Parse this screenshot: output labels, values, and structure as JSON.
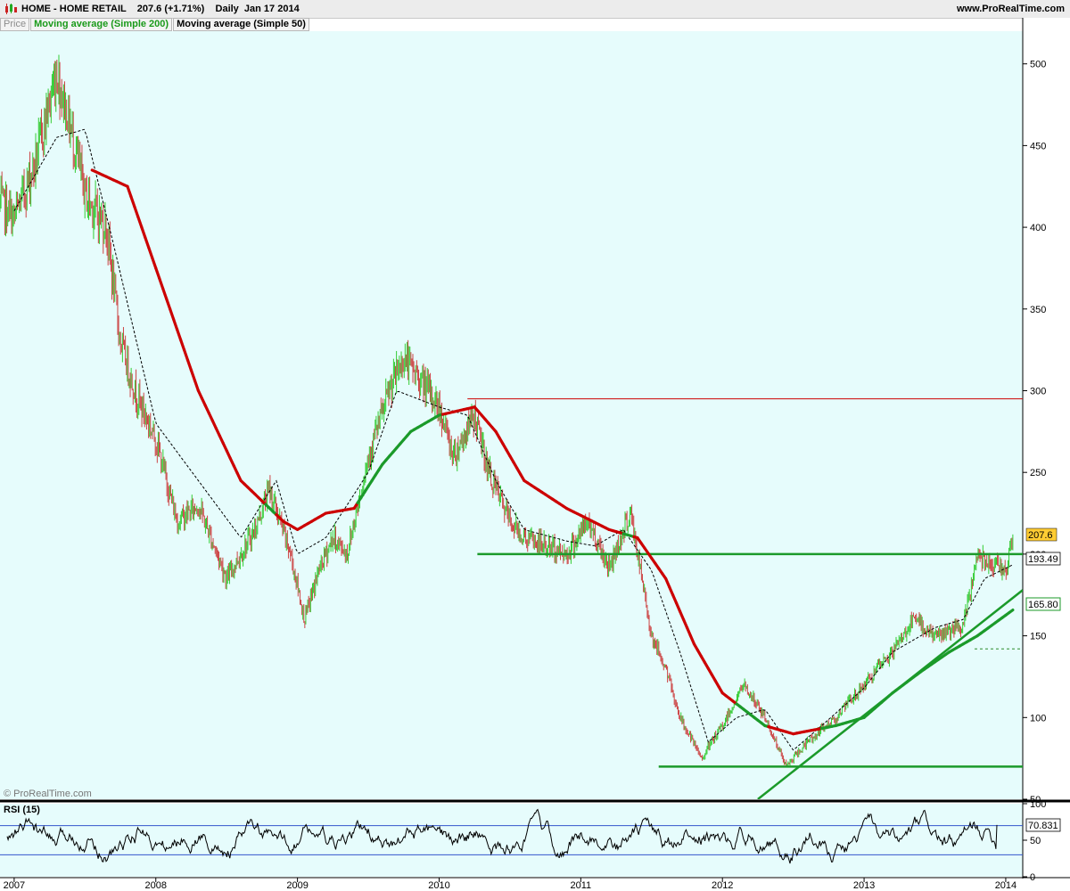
{
  "header": {
    "title": "HOME - HOME RETAIL    207.6 (+1.71%)    Daily  Jan 17 2014",
    "brand": "www.ProRealTime.com"
  },
  "legend": {
    "price": "Price",
    "ma200": "Moving average (Simple 200)",
    "ma50": "Moving average (Simple 50)"
  },
  "copyright": "© ProRealTime.com",
  "rsi_panel": {
    "title": "RSI (15)",
    "value_badge": "70.831"
  },
  "badges": {
    "last_price": "207.6",
    "ma50_value": "193.49",
    "ma200_value": "165.80"
  },
  "colors": {
    "background": "#e6fcfc",
    "up_bar": "#33cc33",
    "down_bar": "#cc4444",
    "ma200_above": "#cc0000",
    "ma200_below": "#1b9a2a",
    "ma50": "#000000",
    "trendline": "#1b9a2a",
    "resistance": "#cc0000"
  },
  "chart_data": [
    {
      "type": "line",
      "title": "HOME - HOME RETAIL",
      "period": "Daily",
      "ylim": [
        50,
        520
      ],
      "yticks": [
        50,
        100,
        150,
        200,
        250,
        300,
        350,
        400,
        450,
        500
      ],
      "x_labels": [
        "2007",
        "2008",
        "2009",
        "2010",
        "2011",
        "2012",
        "2013",
        "2014"
      ],
      "x_range": [
        2006.9,
        2014.12
      ],
      "last_close": 207.6,
      "change_pct": 1.71,
      "price_keypoints": {
        "x": [
          2006.9,
          2007.0,
          2007.15,
          2007.3,
          2007.4,
          2007.5,
          2007.65,
          2007.75,
          2007.85,
          2008.0,
          2008.15,
          2008.3,
          2008.5,
          2008.7,
          2008.8,
          2008.95,
          2009.05,
          2009.15,
          2009.25,
          2009.35,
          2009.5,
          2009.65,
          2009.75,
          2009.88,
          2010.0,
          2010.1,
          2010.25,
          2010.35,
          2010.5,
          2010.6,
          2010.75,
          2010.9,
          2011.05,
          2011.2,
          2011.35,
          2011.5,
          2011.6,
          2011.7,
          2011.85,
          2012.0,
          2012.15,
          2012.3,
          2012.45,
          2012.6,
          2012.8,
          2013.0,
          2013.2,
          2013.35,
          2013.5,
          2013.7,
          2013.8,
          2013.9,
          2014.0,
          2014.05
        ],
        "y": [
          415,
          405,
          440,
          495,
          460,
          420,
          400,
          330,
          300,
          270,
          220,
          230,
          185,
          215,
          240,
          200,
          160,
          190,
          210,
          200,
          260,
          300,
          320,
          305,
          290,
          260,
          285,
          250,
          220,
          210,
          205,
          200,
          220,
          192,
          225,
          150,
          130,
          100,
          75,
          95,
          120,
          100,
          70,
          85,
          100,
          120,
          140,
          160,
          150,
          155,
          200,
          195,
          190,
          207.6
        ]
      },
      "series": [
        {
          "name": "Moving average (Simple 200)",
          "last": 165.8,
          "x": [
            2007.55,
            2007.8,
            2008.0,
            2008.3,
            2008.6,
            2008.9,
            2009.0,
            2009.2,
            2009.4,
            2009.6,
            2009.8,
            2010.0,
            2010.25,
            2010.4,
            2010.6,
            2010.9,
            2011.2,
            2011.4,
            2011.6,
            2011.8,
            2012.0,
            2012.3,
            2012.5,
            2012.8,
            2013.0,
            2013.2,
            2013.4,
            2013.6,
            2013.8,
            2014.05
          ],
          "y": [
            435,
            425,
            375,
            300,
            245,
            220,
            215,
            225,
            228,
            255,
            275,
            285,
            290,
            275,
            245,
            228,
            215,
            210,
            185,
            145,
            115,
            95,
            90,
            95,
            100,
            115,
            128,
            140,
            150,
            165.8
          ]
        },
        {
          "name": "Moving average (Simple 50)",
          "last": 193.49,
          "x": [
            2007.0,
            2007.3,
            2007.5,
            2007.7,
            2008.0,
            2008.3,
            2008.6,
            2008.85,
            2009.0,
            2009.2,
            2009.5,
            2009.7,
            2010.0,
            2010.2,
            2010.4,
            2010.6,
            2010.9,
            2011.1,
            2011.3,
            2011.5,
            2011.7,
            2011.9,
            2012.1,
            2012.3,
            2012.5,
            2012.7,
            2013.0,
            2013.2,
            2013.5,
            2013.7,
            2013.85,
            2014.05
          ],
          "y": [
            410,
            455,
            460,
            390,
            280,
            245,
            210,
            245,
            200,
            210,
            250,
            300,
            290,
            285,
            245,
            215,
            208,
            205,
            215,
            190,
            140,
            85,
            100,
            105,
            80,
            95,
            118,
            140,
            155,
            160,
            185,
            193.49
          ]
        }
      ],
      "horizontal_lines": [
        {
          "y": 295,
          "x_from": 2010.2,
          "color": "red"
        },
        {
          "y": 200,
          "x_from": 2010.27,
          "color": "green"
        },
        {
          "y": 70,
          "x_from": 2011.55,
          "color": "green"
        },
        {
          "y": 142,
          "x_from": 2013.78,
          "style": "dashed"
        }
      ],
      "trendline": {
        "from": [
          2012.25,
          50
        ],
        "to": [
          2014.12,
          178
        ]
      },
      "grid": false
    },
    {
      "type": "line",
      "title": "RSI (15)",
      "ylim": [
        0,
        100
      ],
      "yticks": [
        0,
        50,
        100
      ],
      "levels": [
        70,
        30
      ],
      "last": 70.831,
      "legend": "none"
    }
  ]
}
